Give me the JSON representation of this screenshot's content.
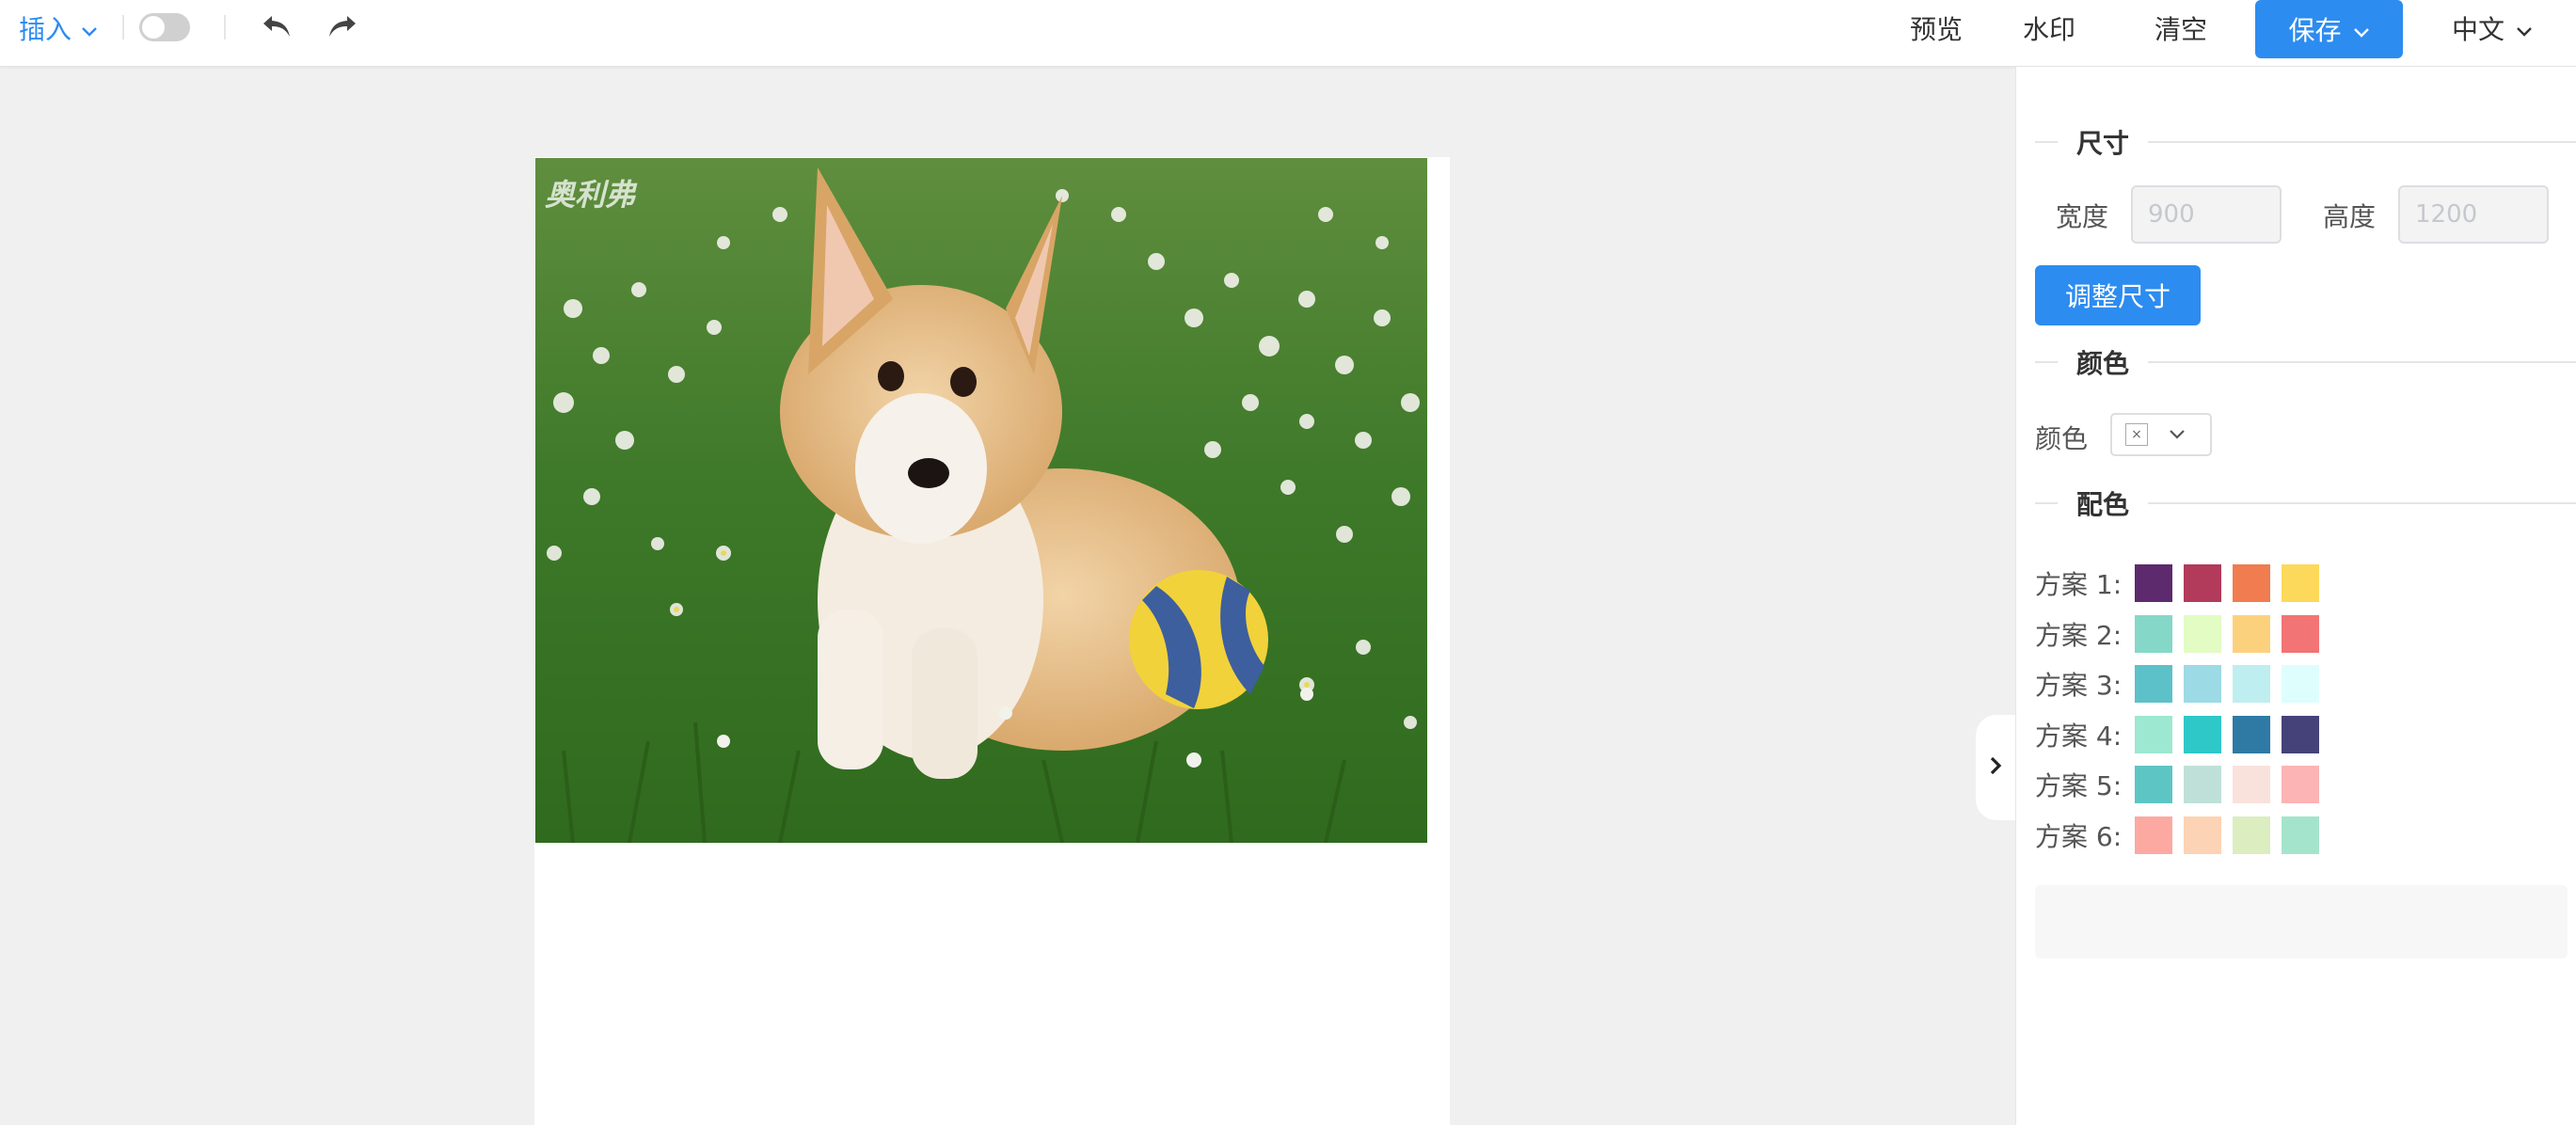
{
  "toolbar": {
    "insert_label": "插入",
    "toggle_on": false,
    "preview_label": "预览",
    "watermark_label": "水印",
    "clear_label": "清空",
    "save_label": "保存",
    "language_label": "中文",
    "accent_color": "#2d8cf0"
  },
  "canvas": {
    "watermark_text": "奥利弗",
    "image_subject": "corgi puppy sitting on grass with a ball"
  },
  "panel": {
    "size_section": {
      "title": "尺寸",
      "width_label": "宽度",
      "width_placeholder": "900",
      "height_label": "高度",
      "height_placeholder": "1200",
      "resize_button": "调整尺寸"
    },
    "color_section": {
      "title": "颜色",
      "color_label": "颜色",
      "selected": "none"
    },
    "palette_section": {
      "title": "配色",
      "schemes": [
        {
          "label": "方案 1:",
          "colors": [
            "#5e2a6e",
            "#b23a5a",
            "#f07c50",
            "#fcd95a"
          ]
        },
        {
          "label": "方案 2:",
          "colors": [
            "#85d8c8",
            "#e2fcc4",
            "#fcd17e",
            "#f27474"
          ]
        },
        {
          "label": "方案 3:",
          "colors": [
            "#5cc1c9",
            "#9cdae6",
            "#bfeef0",
            "#defefd"
          ]
        },
        {
          "label": "方案 4:",
          "colors": [
            "#9ce8d0",
            "#2ec8c8",
            "#2e7aa4",
            "#45427a"
          ]
        },
        {
          "label": "方案 5:",
          "colors": [
            "#5ec5c5",
            "#bfe0d9",
            "#f9e2dc",
            "#fcb4b4"
          ]
        },
        {
          "label": "方案 6:",
          "colors": [
            "#fca9a2",
            "#fcd3b4",
            "#dcedc0",
            "#a5e4cc"
          ]
        }
      ]
    }
  }
}
